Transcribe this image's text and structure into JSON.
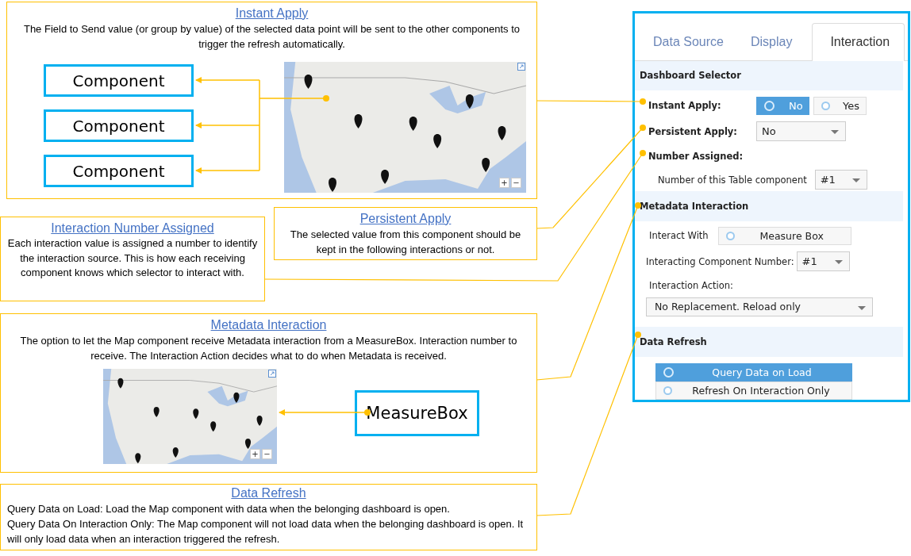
{
  "callouts": [
    {
      "kind": "instant",
      "title": "Instant Apply",
      "paragraphs": [
        "The Field to Send value (or group by value) of the selected data point will be sent to the other components  to trigger the refresh automatically."
      ]
    },
    {
      "kind": "number",
      "title": "Interaction Number Assigned",
      "paragraphs": [
        "Each interaction value is assigned a number to identify the interaction source. This is how each receiving component  knows which selector to interact with."
      ]
    },
    {
      "kind": "persistent",
      "title": "Persistent Apply",
      "paragraphs": [
        "The selected value from this component  should be kept in the following interactions or not."
      ]
    },
    {
      "kind": "metadata",
      "title": "Metadata Interaction",
      "paragraphs": [
        "The option to let the Map component  receive Metadata interaction from  a MeasureBox. Interaction number to receive. The Interaction Action decides what to do when Metadata is received."
      ]
    },
    {
      "kind": "refresh",
      "title": "Data Refresh",
      "paragraphs": [
        "Query Data on Load: Load the Map component  with data when the belonging dashboard is open.",
        "Query Data On Interaction Only: The Map component  will not load data when the belonging dashboard is open.  It will only load data when an interaction triggered the refresh."
      ]
    }
  ],
  "components": [
    "Component",
    "Component",
    "Component"
  ],
  "measure_box": "MeasureBox",
  "maps": [
    {
      "zoom_in": "+",
      "zoom_out": "−"
    },
    {
      "zoom_in": "+",
      "zoom_out": "−"
    }
  ],
  "panel": {
    "tabs": [
      {
        "label": "Data Source",
        "selected": false
      },
      {
        "label": "Display",
        "selected": false
      },
      {
        "label": "Interaction",
        "selected": true
      }
    ],
    "dashboard_selector": {
      "title": "Dashboard Selector",
      "instant_apply": {
        "label": "Instant Apply:",
        "options": [
          {
            "label": "No",
            "selected": true
          },
          {
            "label": "Yes",
            "selected": false
          }
        ]
      },
      "persistent_apply": {
        "label": "Persistent Apply:",
        "value": "No"
      },
      "number_assigned": {
        "label": "Number Assigned:",
        "field_label": "Number of this Table component",
        "value": "#1"
      }
    },
    "metadata_interaction": {
      "title": "Metadata Interaction",
      "interact_with": {
        "label": "Interact With",
        "option": {
          "label": "Measure Box",
          "selected": false
        }
      },
      "component_number": {
        "label": "Interacting Component Number:",
        "value": "#1"
      },
      "action": {
        "label": "Interaction Action:",
        "value": "No Replacement. Reload only"
      }
    },
    "data_refresh": {
      "title": "Data Refresh",
      "options": [
        {
          "label": "Query Data on Load",
          "selected": true
        },
        {
          "label": "Refresh On Interaction Only",
          "selected": false
        }
      ]
    }
  }
}
